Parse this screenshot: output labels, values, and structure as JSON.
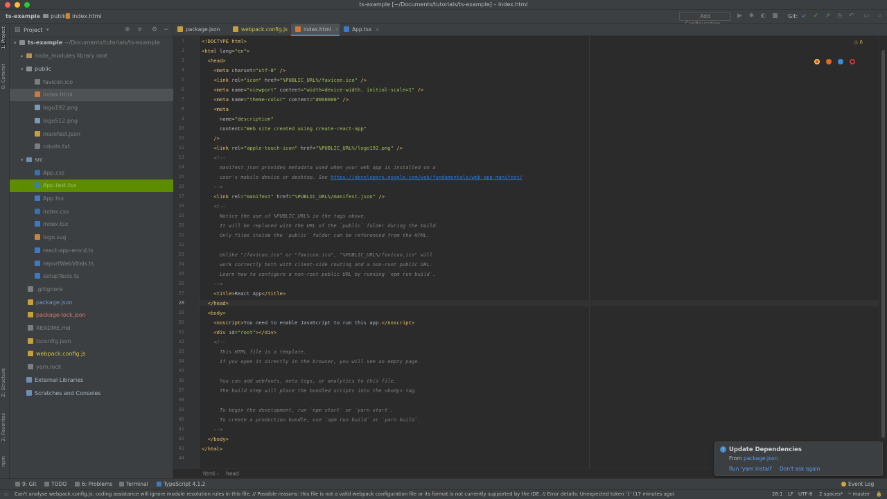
{
  "window": {
    "title": "ts-example [~/Documents/tutorials/ts-example] – index.html"
  },
  "navbar": {
    "crumbs": [
      "ts-example",
      "public",
      "index.html"
    ],
    "add_configuration": "Add Configuration...",
    "git_label": "Git:"
  },
  "left_strip": {
    "tabs": [
      "1: Project",
      "0: Commit",
      "Z: Structure",
      "2: Favorites",
      "npm"
    ]
  },
  "project_panel": {
    "title": "Project",
    "root_name": "ts-example",
    "root_path": "~/Documents/tutorials/ts-example",
    "node_modules": "node_modules",
    "node_modules_note": "library root",
    "items": [
      {
        "label": "public",
        "icon": "folder-icon",
        "color": "normal"
      },
      {
        "label": "favicon.ico",
        "icon": "file-icon",
        "color": "muted"
      },
      {
        "label": "index.html",
        "icon": "html-file-icon",
        "color": "muted"
      },
      {
        "label": "logo192.png",
        "icon": "image-file-icon",
        "color": "muted"
      },
      {
        "label": "logo512.png",
        "icon": "image-file-icon",
        "color": "muted"
      },
      {
        "label": "manifest.json",
        "icon": "json-file-icon",
        "color": "muted"
      },
      {
        "label": "robots.txt",
        "icon": "file-icon",
        "color": "muted"
      },
      {
        "label": "src",
        "icon": "folder-icon",
        "color": "normal"
      },
      {
        "label": "App.css",
        "icon": "css-file-icon",
        "color": "muted"
      },
      {
        "label": "App.test.tsx",
        "icon": "ts-file-icon",
        "color": "muted"
      },
      {
        "label": "App.tsx",
        "icon": "ts-file-icon",
        "color": "muted"
      },
      {
        "label": "index.css",
        "icon": "css-file-icon",
        "color": "muted"
      },
      {
        "label": "index.tsx",
        "icon": "ts-file-icon",
        "color": "muted"
      },
      {
        "label": "logo.svg",
        "icon": "svg-file-icon",
        "color": "muted"
      },
      {
        "label": "react-app-env.d.ts",
        "icon": "ts-file-icon",
        "color": "muted"
      },
      {
        "label": "reportWebVitals.ts",
        "icon": "ts-file-icon",
        "color": "muted"
      },
      {
        "label": "setupTests.ts",
        "icon": "ts-file-icon",
        "color": "muted"
      },
      {
        "label": ".gitignore",
        "icon": "file-icon",
        "color": "muted"
      },
      {
        "label": "package.json",
        "icon": "json-file-icon",
        "color": "blue"
      },
      {
        "label": "package-lock.json",
        "icon": "json-file-icon",
        "color": "red"
      },
      {
        "label": "README.md",
        "icon": "md-file-icon",
        "color": "muted"
      },
      {
        "label": "tsconfig.json",
        "icon": "json-file-icon",
        "color": "muted"
      },
      {
        "label": "webpack.config.js",
        "icon": "js-file-icon",
        "color": "yellow"
      },
      {
        "label": "yarn.lock",
        "icon": "file-icon",
        "color": "muted"
      },
      {
        "label": "External Libraries",
        "icon": "library-icon",
        "color": "normal"
      },
      {
        "label": "Scratches and Consoles",
        "icon": "scratches-icon",
        "color": "normal"
      }
    ]
  },
  "editor_tabs": [
    {
      "label": "package.json",
      "icon": "json-file-icon"
    },
    {
      "label": "webpack.config.js",
      "icon": "js-file-icon"
    },
    {
      "label": "index.html",
      "icon": "html-file-icon",
      "active": true
    },
    {
      "label": "App.tsx",
      "icon": "ts-file-icon"
    }
  ],
  "editor": {
    "warning_count": "6",
    "current_line": 28,
    "line_numbers": [
      "1",
      "2",
      "3",
      "4",
      "5",
      "6",
      "7",
      "8",
      "9",
      "10",
      "11",
      "12",
      "13",
      "14",
      "15",
      "16",
      "17",
      "18",
      "19",
      "20",
      "21",
      "22",
      "23",
      "24",
      "25",
      "26",
      "27",
      "28",
      "29",
      "30",
      "31",
      "32",
      "33",
      "34",
      "35",
      "36",
      "37",
      "38",
      "39",
      "40",
      "41",
      "42",
      "43",
      "44"
    ],
    "lines": [
      [
        [
          "tg",
          "<!DOCTYPE html>"
        ]
      ],
      [
        [
          "tg",
          "<html "
        ],
        [
          "an",
          "lang"
        ],
        [
          "av",
          "=\"en\""
        ],
        [
          "tg",
          ">"
        ]
      ],
      [
        [
          "",
          "  "
        ],
        [
          "tg",
          "<head>"
        ]
      ],
      [
        [
          "",
          "    "
        ],
        [
          "tg",
          "<meta "
        ],
        [
          "an",
          "charset"
        ],
        [
          "av",
          "=\"utf-8\""
        ],
        [
          "tg",
          " />"
        ]
      ],
      [
        [
          "",
          "    "
        ],
        [
          "tg",
          "<link "
        ],
        [
          "an",
          "rel"
        ],
        [
          "av",
          "=\"icon\""
        ],
        [
          "an",
          " href"
        ],
        [
          "av",
          "=\"%PUBLIC_URL%/favicon.ico\""
        ],
        [
          "tg",
          " />"
        ]
      ],
      [
        [
          "",
          "    "
        ],
        [
          "tg",
          "<meta "
        ],
        [
          "an",
          "name"
        ],
        [
          "av",
          "=\"viewport\""
        ],
        [
          "an",
          " content"
        ],
        [
          "av",
          "=\"width=device-width, initial-scale=1\""
        ],
        [
          "tg",
          " />"
        ]
      ],
      [
        [
          "",
          "    "
        ],
        [
          "tg",
          "<meta "
        ],
        [
          "an",
          "name"
        ],
        [
          "av",
          "=\"theme-color\""
        ],
        [
          "an",
          " content"
        ],
        [
          "av",
          "=\"#000000\""
        ],
        [
          "tg",
          " />"
        ]
      ],
      [
        [
          "",
          "    "
        ],
        [
          "tg",
          "<meta"
        ]
      ],
      [
        [
          "",
          "      "
        ],
        [
          "an",
          "name"
        ],
        [
          "av",
          "=\"description\""
        ]
      ],
      [
        [
          "",
          "      "
        ],
        [
          "an",
          "content"
        ],
        [
          "av",
          "=\"Web site created using create-react-app\""
        ]
      ],
      [
        [
          "",
          "    "
        ],
        [
          "tg",
          "/>"
        ]
      ],
      [
        [
          "",
          "    "
        ],
        [
          "tg",
          "<link "
        ],
        [
          "an",
          "rel"
        ],
        [
          "av",
          "=\"apple-touch-icon\""
        ],
        [
          "an",
          " href"
        ],
        [
          "av",
          "=\"%PUBLIC_URL%/logo192.png\""
        ],
        [
          "tg",
          " />"
        ]
      ],
      [
        [
          "",
          "    "
        ],
        [
          "cm",
          "<!--"
        ]
      ],
      [
        [
          "",
          "      "
        ],
        [
          "cm",
          "manifest.json provides metadata used when your web app is installed on a"
        ]
      ],
      [
        [
          "",
          "      "
        ],
        [
          "cm",
          "user's mobile device or desktop. See "
        ],
        [
          "ln",
          "https://developers.google.com/web/fundamentals/web-app-manifest/"
        ]
      ],
      [
        [
          "",
          "    "
        ],
        [
          "cm",
          "-->"
        ]
      ],
      [
        [
          "",
          "    "
        ],
        [
          "tg",
          "<link "
        ],
        [
          "an",
          "rel"
        ],
        [
          "av",
          "=\"manifest\""
        ],
        [
          "an",
          " href"
        ],
        [
          "av",
          "=\"%PUBLIC_URL%/manifest.json\""
        ],
        [
          "tg",
          " />"
        ]
      ],
      [
        [
          "",
          "    "
        ],
        [
          "cm",
          "<!--"
        ]
      ],
      [
        [
          "",
          "      "
        ],
        [
          "cm",
          "Notice the use of %PUBLIC_URL% in the tags above."
        ]
      ],
      [
        [
          "",
          "      "
        ],
        [
          "cm",
          "It will be replaced with the URL of the `public` folder during the build."
        ]
      ],
      [
        [
          "",
          "      "
        ],
        [
          "cm",
          "Only files inside the `public` folder can be referenced from the HTML."
        ]
      ],
      [
        [
          "",
          ""
        ]
      ],
      [
        [
          "",
          "      "
        ],
        [
          "cm",
          "Unlike \"/favicon.ico\" or \"favicon.ico\", \"%PUBLIC_URL%/favicon.ico\" will"
        ]
      ],
      [
        [
          "",
          "      "
        ],
        [
          "cm",
          "work correctly both with client-side routing and a non-root public URL."
        ]
      ],
      [
        [
          "",
          "      "
        ],
        [
          "cm",
          "Learn how to configure a non-root public URL by running `npm run build`."
        ]
      ],
      [
        [
          "",
          "    "
        ],
        [
          "cm",
          "-->"
        ]
      ],
      [
        [
          "",
          "    "
        ],
        [
          "tg",
          "<title>"
        ],
        [
          "",
          "React App"
        ],
        [
          "tg",
          "</title>"
        ]
      ],
      [
        [
          "",
          "  "
        ],
        [
          "tg",
          "</head>"
        ]
      ],
      [
        [
          "",
          "  "
        ],
        [
          "tg",
          "<body>"
        ]
      ],
      [
        [
          "",
          "    "
        ],
        [
          "tg",
          "<noscript>"
        ],
        [
          "",
          "You need to enable JavaScript to run this app."
        ],
        [
          "tg",
          "</noscript>"
        ]
      ],
      [
        [
          "",
          "    "
        ],
        [
          "tg",
          "<div "
        ],
        [
          "an",
          "id"
        ],
        [
          "av",
          "=\"root\""
        ],
        [
          "tg",
          "></div>"
        ]
      ],
      [
        [
          "",
          "    "
        ],
        [
          "cm",
          "<!--"
        ]
      ],
      [
        [
          "",
          "      "
        ],
        [
          "cm",
          "This HTML file is a template."
        ]
      ],
      [
        [
          "",
          "      "
        ],
        [
          "cm",
          "If you open it directly in the browser, you will see an empty page."
        ]
      ],
      [
        [
          "",
          ""
        ]
      ],
      [
        [
          "",
          "      "
        ],
        [
          "cm",
          "You can add webfonts, meta tags, or analytics to this file."
        ]
      ],
      [
        [
          "",
          "      "
        ],
        [
          "cm",
          "The build step will place the bundled scripts into the <body> tag."
        ]
      ],
      [
        [
          "",
          ""
        ]
      ],
      [
        [
          "",
          "      "
        ],
        [
          "cm",
          "To begin the development, run `npm start` or `yarn start`."
        ]
      ],
      [
        [
          "",
          "      "
        ],
        [
          "cm",
          "To create a production bundle, use `npm run build` or `yarn build`."
        ]
      ],
      [
        [
          "",
          "    "
        ],
        [
          "cm",
          "-->"
        ]
      ],
      [
        [
          "",
          "  "
        ],
        [
          "tg",
          "</body>"
        ]
      ],
      [
        [
          "tg",
          "</html>"
        ]
      ],
      [
        [
          "",
          ""
        ]
      ]
    ]
  },
  "editor_breadcrumb": [
    "html",
    "head"
  ],
  "bottom_tabs": [
    "9: Git",
    "TODO",
    "6: Problems",
    "Terminal",
    "TypeScript 4.1.2"
  ],
  "event_log": "Event Log",
  "notification": {
    "title": "Update Dependencies",
    "from": "From",
    "from_link": "package.json",
    "action_install": "Run 'yarn install'",
    "action_dismiss": "Don't ask again"
  },
  "status": {
    "message": "Can't analyse webpack.config.js: coding assistance will ignore module resolution rules in this file. // Possible reasons: this file is not a valid webpack configuration file or its format is not currently supported by the IDE. // Error details: Unexpected token '}' (17 minutes ago)",
    "position": "28:1",
    "line_sep": "LF",
    "encoding": "UTF-8",
    "indent": "2 spaces*",
    "branch": "master"
  },
  "colors": {
    "accent": "#4a88c7",
    "selection_green": "#5e8c00",
    "tag": "#e8bf6a",
    "string": "#a5c25c",
    "comment": "#808080"
  }
}
